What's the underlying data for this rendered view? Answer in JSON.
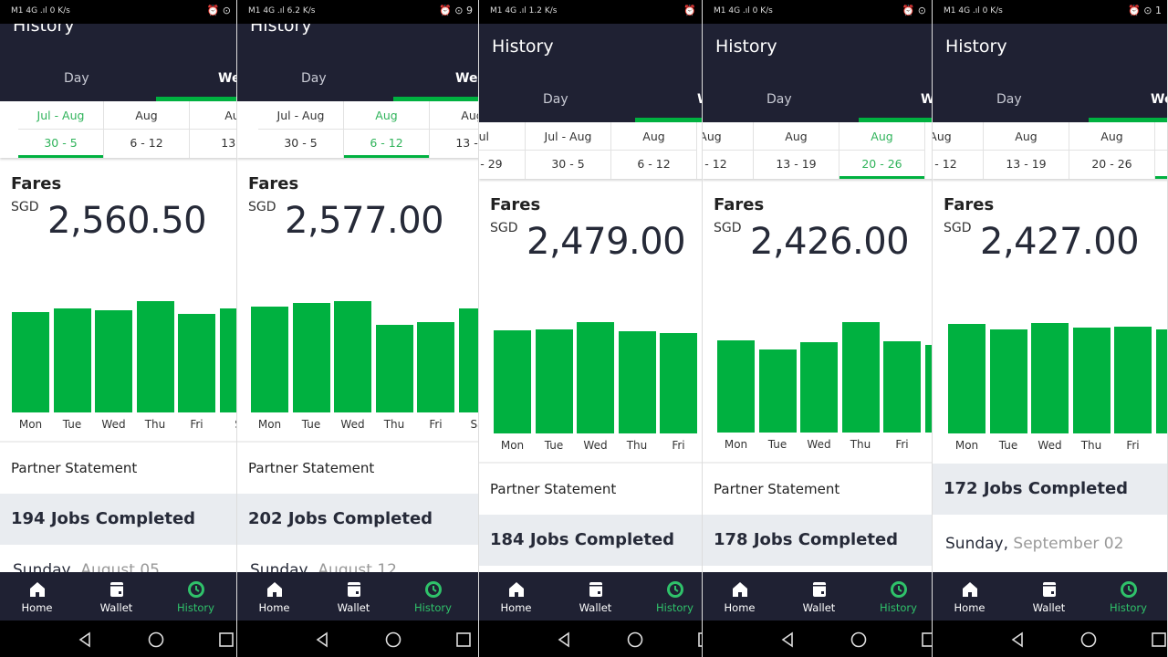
{
  "colors": {
    "header_bg": "#1f2133",
    "accent": "#00b140",
    "bar": "#00b140",
    "jobs_bg": "#e9ecf0"
  },
  "panels": [
    {
      "status": {
        "carrier": "M1 4G .ıl",
        "speed": "0 K/s",
        "right_icons": "⏰ ⊙"
      },
      "title": "History",
      "tabs": [
        "Day",
        "We"
      ],
      "weeks": [
        {
          "month": "Jul - Aug",
          "range": "30 - 5",
          "selected": true
        },
        {
          "month": "Aug",
          "range": "6 - 12"
        },
        {
          "month": "Au",
          "range": "13 -"
        }
      ],
      "fares_label": "Fares",
      "currency": "SGD",
      "amount": "2,560.50",
      "bars": [
        {
          "day": "Mon",
          "level": 0.85
        },
        {
          "day": "Tue",
          "level": 0.88
        },
        {
          "day": "Wed",
          "level": 0.86
        },
        {
          "day": "Thu",
          "level": 0.94
        },
        {
          "day": "Fri",
          "level": 0.83
        },
        {
          "day": "S",
          "level": 0.88
        }
      ],
      "partner_statement": "Partner Statement",
      "jobs": "194 Jobs Completed",
      "day_row": {
        "weekday": "Sunday,",
        "date": "August 05"
      }
    },
    {
      "status": {
        "carrier": "M1 4G .ıl",
        "speed": "6.2 K/s",
        "right_icons": "⏰ ⊙ 9"
      },
      "title": "History",
      "tabs": [
        "Day",
        "Wee"
      ],
      "weeks": [
        {
          "month": "Jul - Aug",
          "range": "30 - 5"
        },
        {
          "month": "Aug",
          "range": "6 - 12",
          "selected": true
        },
        {
          "month": "Aug",
          "range": "13 - 1"
        }
      ],
      "fares_label": "Fares",
      "currency": "SGD",
      "amount": "2,577.00",
      "bars": [
        {
          "day": "Mon",
          "level": 0.89
        },
        {
          "day": "Tue",
          "level": 0.92
        },
        {
          "day": "Wed",
          "level": 0.94
        },
        {
          "day": "Thu",
          "level": 0.74
        },
        {
          "day": "Fri",
          "level": 0.76
        },
        {
          "day": "Sa",
          "level": 0.88
        }
      ],
      "partner_statement": "Partner Statement",
      "jobs": "202 Jobs Completed",
      "day_row": {
        "weekday": "Sunday,",
        "date": "August 12"
      }
    },
    {
      "status": {
        "carrier": "M1 4G .ıl",
        "speed": "1.2 K/s",
        "right_icons": "⏰"
      },
      "title": "History",
      "tabs": [
        "Day",
        "W"
      ],
      "weeks": [
        {
          "month": "Jul",
          "range": "23 - 29"
        },
        {
          "month": "Jul - Aug",
          "range": "30 - 5"
        },
        {
          "month": "Aug",
          "range": "6 - 12"
        }
      ],
      "fares_label": "Fares",
      "currency": "SGD",
      "amount": "2,479.00",
      "bars": [
        {
          "day": "Mon",
          "level": 0.87
        },
        {
          "day": "Tue",
          "level": 0.88
        },
        {
          "day": "Wed",
          "level": 0.94
        },
        {
          "day": "Thu",
          "level": 0.86
        },
        {
          "day": "Fri",
          "level": 0.85
        }
      ],
      "partner_statement": "Partner Statement",
      "jobs": "184 Jobs Completed",
      "day_row": null
    },
    {
      "status": {
        "carrier": "M1 4G .ıl",
        "speed": "0 K/s",
        "right_icons": "⏰ ⊙"
      },
      "title": "History",
      "tabs": [
        "Day",
        "W"
      ],
      "weeks": [
        {
          "month": "Aug",
          "range": "6 - 12"
        },
        {
          "month": "Aug",
          "range": "13 - 19"
        },
        {
          "month": "Aug",
          "range": "20 - 26",
          "selected": true
        }
      ],
      "fares_label": "Fares",
      "currency": "SGD",
      "amount": "2,426.00",
      "bars": [
        {
          "day": "Mon",
          "level": 0.78
        },
        {
          "day": "Tue",
          "level": 0.7
        },
        {
          "day": "Wed",
          "level": 0.76
        },
        {
          "day": "Thu",
          "level": 0.93
        },
        {
          "day": "Fri",
          "level": 0.77
        },
        {
          "day": "",
          "level": 0.74
        }
      ],
      "partner_statement": "Partner Statement",
      "jobs": "178 Jobs Completed",
      "day_row": null
    },
    {
      "status": {
        "carrier": "M1 4G .ıl",
        "speed": "0 K/s",
        "right_icons": "⏰ ⊙ 1"
      },
      "title": "History",
      "tabs": [
        "Day",
        "We"
      ],
      "weeks": [
        {
          "month": "Aug",
          "range": "6 - 12"
        },
        {
          "month": "Aug",
          "range": "13 - 19"
        },
        {
          "month": "Aug",
          "range": "20 - 26"
        },
        {
          "month": "",
          "range": "",
          "selected": true
        }
      ],
      "fares_label": "Fares",
      "currency": "SGD",
      "amount": "2,427.00",
      "bars": [
        {
          "day": "Mon",
          "level": 0.92
        },
        {
          "day": "Tue",
          "level": 0.88
        },
        {
          "day": "Wed",
          "level": 0.93
        },
        {
          "day": "Thu",
          "level": 0.89
        },
        {
          "day": "Fri",
          "level": 0.9
        },
        {
          "day": "S",
          "level": 0.88
        }
      ],
      "partner_statement": null,
      "jobs": "172 Jobs Completed",
      "day_row": {
        "weekday": "Sunday,",
        "date": "September 02"
      }
    }
  ],
  "bottom_nav": [
    {
      "label": "Home",
      "icon": "home-icon"
    },
    {
      "label": "Wallet",
      "icon": "wallet-icon"
    },
    {
      "label": "History",
      "icon": "history-icon",
      "active": true
    }
  ],
  "system_nav": [
    "back-icon",
    "home-circle-icon",
    "recents-icon"
  ]
}
